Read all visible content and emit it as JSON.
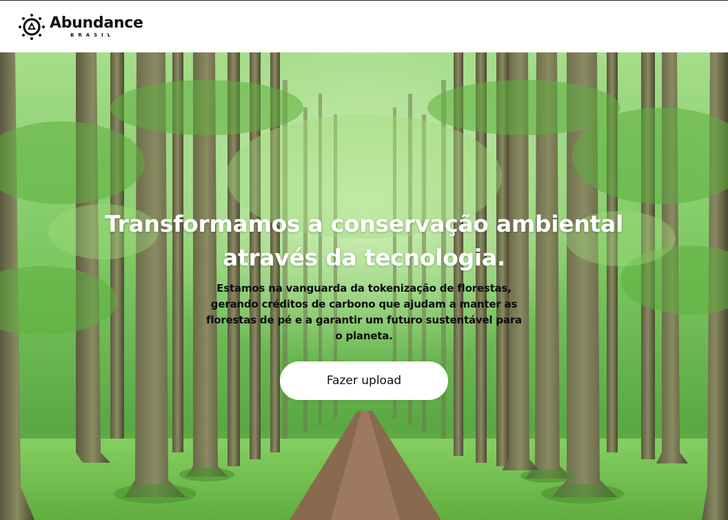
{
  "brand": {
    "name": "Abundance",
    "subtitle": "BRASIL"
  },
  "hero": {
    "headline": "Transformamos a conservação ambiental através da tecnologia.",
    "description": "Estamos na vanguarda da tokenização de florestas, gerando créditos de carbono que ajudam a manter as florestas de pé e a garantir um futuro sustentável para o planeta.",
    "cta_label": "Fazer upload"
  },
  "colors": {
    "header_bg": "#ffffff",
    "button_bg": "#ffffff",
    "headline_text": "#ffffff",
    "body_text": "#0c0c0c",
    "forest_green": "#6dbb55"
  },
  "icons": {
    "logo": "abundance-logo-icon"
  }
}
